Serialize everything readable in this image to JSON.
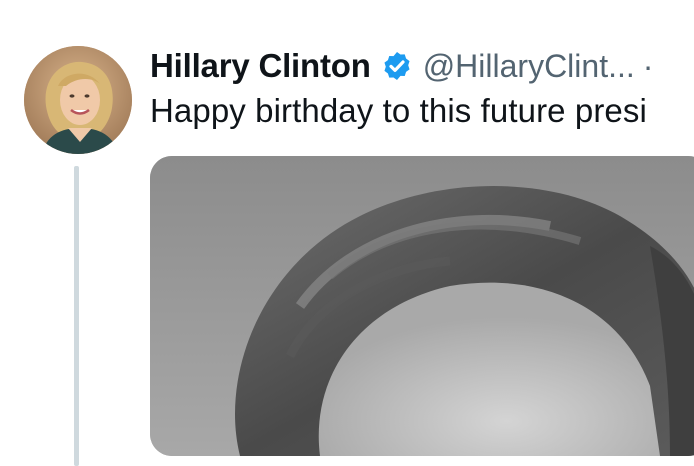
{
  "tweet": {
    "author_name": "Hillary Clinton",
    "handle": "@HillaryClint...",
    "separator": "·",
    "text": "Happy birthday to this future presi",
    "verified_color": "#1d9bf0",
    "avatar_icon": "profile-photo",
    "media_icon": "black-and-white-portrait-photo"
  }
}
